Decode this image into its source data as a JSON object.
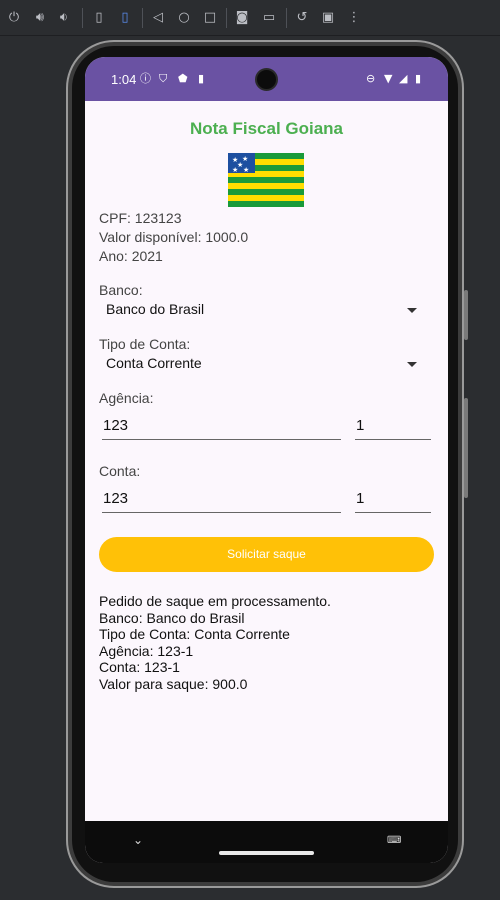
{
  "toolbar": {
    "icons": [
      "power-icon",
      "volume-up-icon",
      "volume-down-icon",
      "rotate-left-icon",
      "rotate-right-icon",
      "back-icon",
      "home-icon",
      "overview-icon",
      "screenshot-icon",
      "screen-record-icon",
      "snapshot-icon",
      "fold-icon",
      "more-icon"
    ]
  },
  "statusbar": {
    "time": "1:04"
  },
  "app": {
    "title": "Nota Fiscal Goiana",
    "colors": {
      "title": "#4caf50",
      "button": "#ffc107",
      "statusbar": "#6a52a3"
    },
    "info": {
      "cpf": "CPF: 123123",
      "valor": "Valor disponível: 1000.0",
      "ano": "Ano: 2021"
    },
    "banco": {
      "label": "Banco:",
      "value": "Banco do Brasil"
    },
    "tipo_conta": {
      "label": "Tipo de Conta:",
      "value": "Conta Corrente"
    },
    "agencia": {
      "label": "Agência:",
      "number": "123",
      "digit": "1"
    },
    "conta": {
      "label": "Conta:",
      "number": "123",
      "digit": "1"
    },
    "button_label": "Solicitar saque",
    "result": {
      "line1": "Pedido de saque em processamento.",
      "line2": "Banco: Banco do Brasil",
      "line3": "Tipo de Conta: Conta Corrente",
      "line4": "Agência: 123-1",
      "line5": "Conta: 123-1",
      "line6": "Valor para saque: 900.0"
    }
  }
}
